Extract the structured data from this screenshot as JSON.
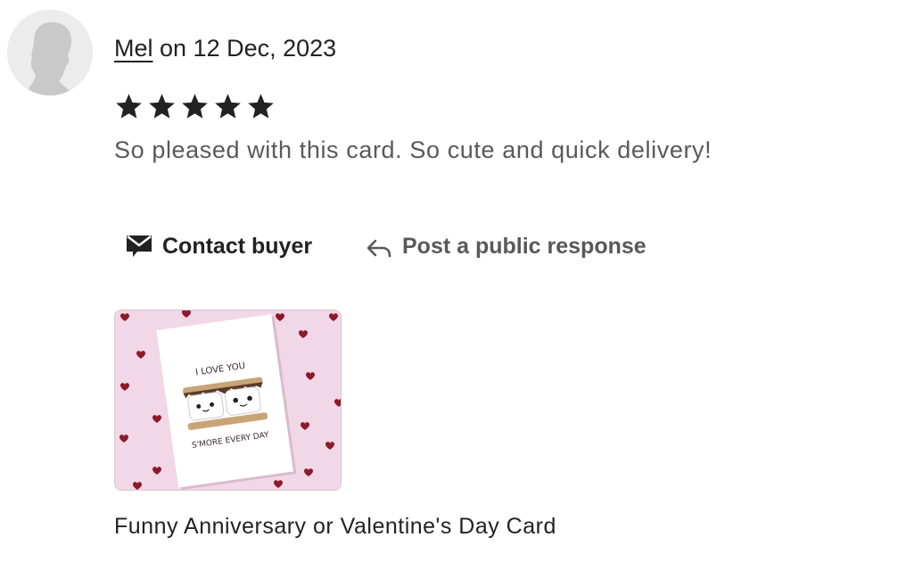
{
  "review": {
    "reviewer_name": "Mel",
    "date_text": " on 12 Dec, 2023",
    "rating": 5,
    "rating_max": 5,
    "text": "So pleased with this card. So cute and quick delivery!"
  },
  "actions": {
    "contact_label": "Contact buyer",
    "contact_icon": "envelope-icon",
    "respond_label": "Post a public response",
    "respond_icon": "reply-arrow-icon"
  },
  "listing": {
    "title": "Funny Anniversary or Valentine's Day Card",
    "card_text_top": "I LOVE YOU",
    "card_text_bottom": "S'MORE EVERY DAY"
  },
  "colors": {
    "star": "#222222",
    "text_primary": "#222222",
    "text_secondary": "#595959",
    "image_background": "#f2d7e6",
    "heart": "#8b1a2c"
  }
}
